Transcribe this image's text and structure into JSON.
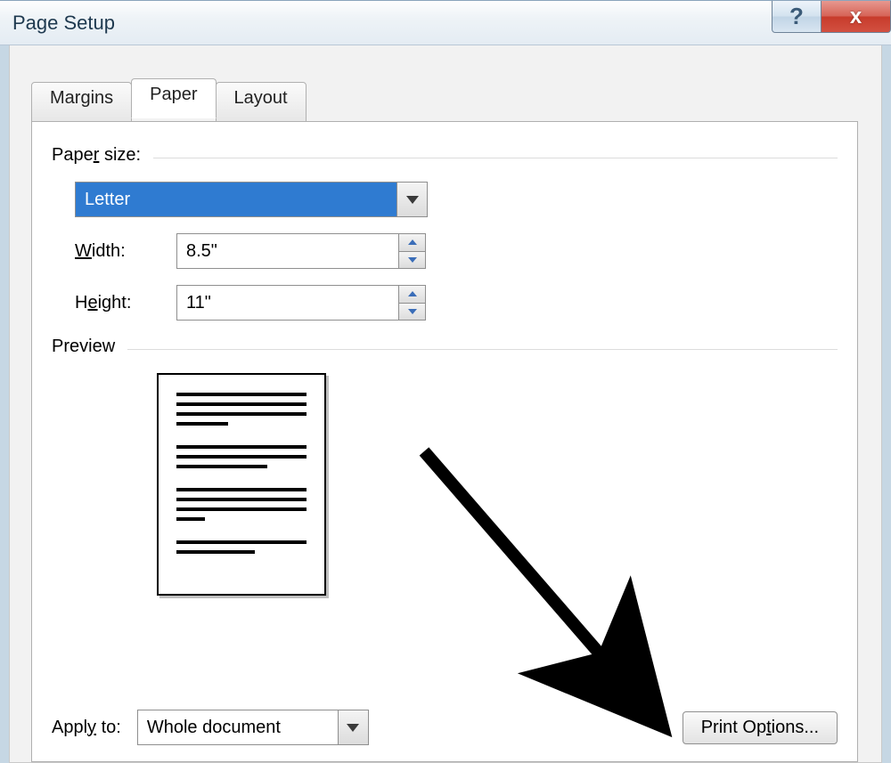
{
  "window": {
    "title": "Page Setup"
  },
  "tabs": {
    "margins": "Margins",
    "paper": "Paper",
    "layout": "Layout",
    "active": "paper"
  },
  "paper": {
    "size_label": "Paper size:",
    "size_value": "Letter",
    "width_label": "Width:",
    "width_value": "8.5\"",
    "height_label": "Height:",
    "height_value": "11\""
  },
  "preview": {
    "label": "Preview"
  },
  "apply": {
    "label": "Apply to:",
    "value": "Whole document"
  },
  "buttons": {
    "print_options": "Print Options..."
  }
}
